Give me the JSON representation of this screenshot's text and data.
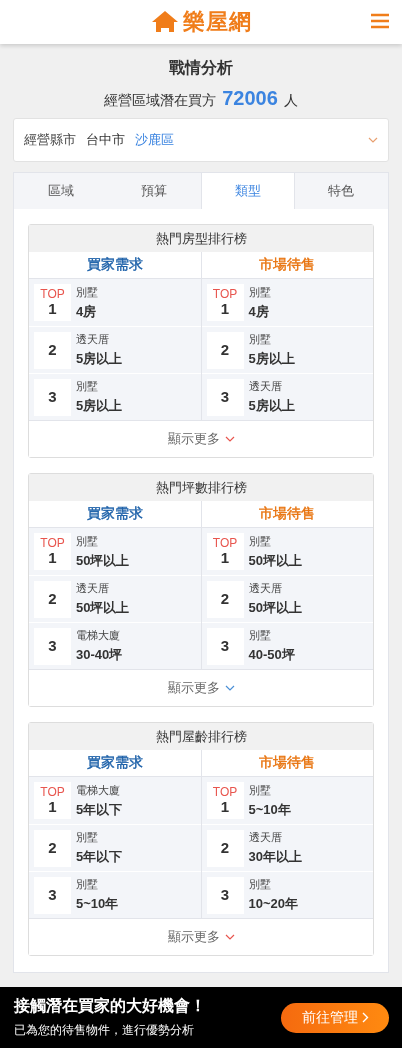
{
  "header": {
    "logo_text": "樂屋網"
  },
  "page_title": "戰情分析",
  "summary": {
    "prefix": "經營區域潛在買方",
    "count": "72006",
    "suffix": "人"
  },
  "selector": {
    "label": "經營縣市",
    "city": "台中市",
    "district": "沙鹿區"
  },
  "tabs": [
    {
      "label": "區域",
      "selected": false
    },
    {
      "label": "預算",
      "selected": false
    },
    {
      "label": "類型",
      "selected": true
    },
    {
      "label": "特色",
      "selected": false
    }
  ],
  "rankings": [
    {
      "title": "熱門房型排行榜",
      "columns": [
        {
          "heading": "買家需求",
          "color": "#1a5fa8",
          "rows": [
            {
              "badge": "TOP",
              "rank": "1",
              "type": "別墅",
              "value": "4房"
            },
            {
              "rank": "2",
              "type": "透天厝",
              "value": "5房以上"
            },
            {
              "rank": "3",
              "type": "別墅",
              "value": "5房以上"
            }
          ]
        },
        {
          "heading": "市場待售",
          "color": "#e8720c",
          "rows": [
            {
              "badge": "TOP",
              "rank": "1",
              "type": "別墅",
              "value": "4房"
            },
            {
              "rank": "2",
              "type": "別墅",
              "value": "5房以上"
            },
            {
              "rank": "3",
              "type": "透天厝",
              "value": "5房以上"
            }
          ]
        }
      ],
      "more": {
        "label": "顯示更多",
        "color": "#e8554e"
      }
    },
    {
      "title": "熱門坪數排行榜",
      "columns": [
        {
          "heading": "買家需求",
          "color": "#1a5fa8",
          "rows": [
            {
              "badge": "TOP",
              "rank": "1",
              "type": "別墅",
              "value": "50坪以上"
            },
            {
              "rank": "2",
              "type": "透天厝",
              "value": "50坪以上"
            },
            {
              "rank": "3",
              "type": "電梯大廈",
              "value": "30-40坪"
            }
          ]
        },
        {
          "heading": "市場待售",
          "color": "#e8720c",
          "rows": [
            {
              "badge": "TOP",
              "rank": "1",
              "type": "別墅",
              "value": "50坪以上"
            },
            {
              "rank": "2",
              "type": "透天厝",
              "value": "50坪以上"
            },
            {
              "rank": "3",
              "type": "別墅",
              "value": "40-50坪"
            }
          ]
        }
      ],
      "more": {
        "label": "顯示更多",
        "color": "#4a8fd6"
      }
    },
    {
      "title": "熱門屋齡排行榜",
      "columns": [
        {
          "heading": "買家需求",
          "color": "#1a5fa8",
          "rows": [
            {
              "badge": "TOP",
              "rank": "1",
              "type": "電梯大廈",
              "value": "5年以下"
            },
            {
              "rank": "2",
              "type": "別墅",
              "value": "5年以下"
            },
            {
              "rank": "3",
              "type": "別墅",
              "value": "5~10年"
            }
          ]
        },
        {
          "heading": "市場待售",
          "color": "#e8720c",
          "rows": [
            {
              "badge": "TOP",
              "rank": "1",
              "type": "別墅",
              "value": "5~10年"
            },
            {
              "rank": "2",
              "type": "透天厝",
              "value": "30年以上"
            },
            {
              "rank": "3",
              "type": "別墅",
              "value": "10~20年"
            }
          ]
        }
      ],
      "more": {
        "label": "顯示更多",
        "color": "#e8554e"
      }
    }
  ],
  "banner": {
    "headline": "接觸潛在買家的大好機會！",
    "subline": "已為您的待售物件，進行優勢分析",
    "button": "前往管理"
  }
}
